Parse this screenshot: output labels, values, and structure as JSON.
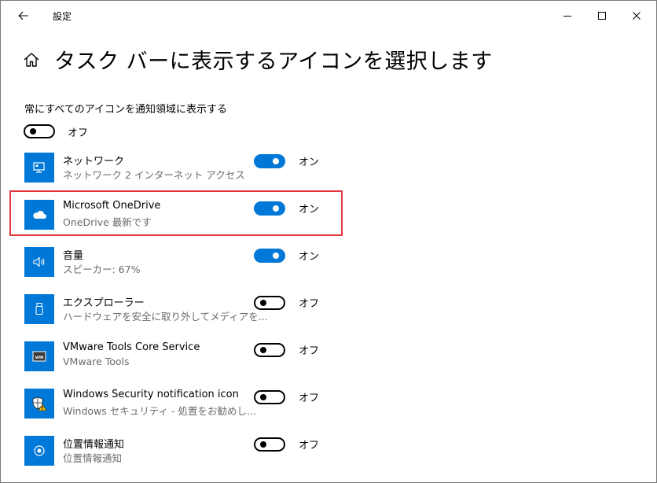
{
  "window": {
    "title": "設定"
  },
  "page": {
    "title": "タスク バーに表示するアイコンを選択します"
  },
  "always_show": {
    "label": "常にすべてのアイコンを通知領域に表示する",
    "state": "off",
    "state_label": "オフ"
  },
  "items": [
    {
      "name": "ネットワーク",
      "desc": "ネットワーク 2 インターネット アクセス",
      "icon": "network-icon",
      "state": "on",
      "state_label": "オン"
    },
    {
      "name": "Microsoft OneDrive",
      "desc": "OneDrive 最新です",
      "icon": "cloud-icon",
      "state": "on",
      "state_label": "オン",
      "highlighted": true
    },
    {
      "name": "音量",
      "desc": "スピーカー: 67%",
      "icon": "speaker-icon",
      "state": "on",
      "state_label": "オン"
    },
    {
      "name": "エクスプローラー",
      "desc": "ハードウェアを安全に取り外してメディアを...",
      "icon": "usb-icon",
      "state": "off",
      "state_label": "オフ"
    },
    {
      "name": "VMware Tools Core Service",
      "desc": "VMware Tools",
      "icon": "vmware-icon",
      "state": "off",
      "state_label": "オフ"
    },
    {
      "name": "Windows Security notification icon",
      "desc": "Windows セキュリティ - 処置をお勧めし...",
      "icon": "shield-icon",
      "state": "off",
      "state_label": "オフ"
    },
    {
      "name": "位置情報通知",
      "desc": "位置情報通知",
      "icon": "location-icon",
      "state": "off",
      "state_label": "オフ"
    }
  ],
  "colors": {
    "accent": "#0078d7",
    "highlight_border": "#e0363c",
    "secondary_text": "#6b6b6b"
  }
}
